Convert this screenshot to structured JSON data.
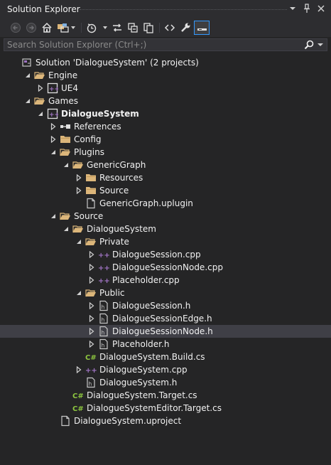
{
  "panel": {
    "title": "Solution Explorer",
    "title_icons": [
      "chevron-down-icon",
      "pin-icon",
      "close-icon"
    ]
  },
  "toolbar": {
    "buttons": [
      "back-icon",
      "forward-icon",
      "home-icon",
      "switch-views-icon",
      "pending-changes-filter-icon",
      "sync-icon",
      "collapse-all-icon",
      "show-all-files-icon",
      "view-code-icon",
      "properties-icon",
      "preview-selected-icon"
    ]
  },
  "search": {
    "placeholder": "Search Solution Explorer (Ctrl+;)",
    "value": ""
  },
  "colors": {
    "background": "#252526",
    "folder": "#dcb67a",
    "cpp": "#a074c4",
    "csharp": "#8dc63f",
    "selection": "#3f3f46",
    "accent": "#3399ff"
  },
  "tree": [
    {
      "label": "Solution 'DialogueSystem' (2 projects)",
      "icon": "solution-icon",
      "expander": "none",
      "bold": false
    },
    {
      "label": "Engine",
      "icon": "folder-open-icon",
      "expander": "expanded",
      "bold": false
    },
    {
      "label": "UE4",
      "icon": "cpp-project-icon",
      "expander": "collapsed",
      "bold": false
    },
    {
      "label": "Games",
      "icon": "folder-open-icon",
      "expander": "expanded",
      "bold": false
    },
    {
      "label": "DialogueSystem",
      "icon": "cpp-project-icon",
      "expander": "expanded",
      "bold": true
    },
    {
      "label": "References",
      "icon": "references-icon",
      "expander": "collapsed",
      "bold": false
    },
    {
      "label": "Config",
      "icon": "folder-icon",
      "expander": "collapsed",
      "bold": false
    },
    {
      "label": "Plugins",
      "icon": "folder-open-icon",
      "expander": "expanded",
      "bold": false
    },
    {
      "label": "GenericGraph",
      "icon": "folder-open-icon",
      "expander": "expanded",
      "bold": false
    },
    {
      "label": "Resources",
      "icon": "folder-icon",
      "expander": "collapsed",
      "bold": false
    },
    {
      "label": "Source",
      "icon": "folder-icon",
      "expander": "collapsed",
      "bold": false
    },
    {
      "label": "GenericGraph.uplugin",
      "icon": "file-icon",
      "expander": "none",
      "bold": false
    },
    {
      "label": "Source",
      "icon": "folder-open-icon",
      "expander": "expanded",
      "bold": false
    },
    {
      "label": "DialogueSystem",
      "icon": "folder-open-icon",
      "expander": "expanded",
      "bold": false
    },
    {
      "label": "Private",
      "icon": "folder-open-icon",
      "expander": "expanded",
      "bold": false
    },
    {
      "label": "DialogueSession.cpp",
      "icon": "cpp-file-icon",
      "expander": "collapsed",
      "bold": false
    },
    {
      "label": "DialogueSessionNode.cpp",
      "icon": "cpp-file-icon",
      "expander": "collapsed",
      "bold": false
    },
    {
      "label": "Placeholder.cpp",
      "icon": "cpp-file-icon",
      "expander": "collapsed",
      "bold": false
    },
    {
      "label": "Public",
      "icon": "folder-open-icon",
      "expander": "expanded",
      "bold": false
    },
    {
      "label": "DialogueSession.h",
      "icon": "header-file-icon",
      "expander": "collapsed",
      "bold": false
    },
    {
      "label": "DialogueSessionEdge.h",
      "icon": "header-file-icon",
      "expander": "collapsed",
      "bold": false
    },
    {
      "label": "DialogueSessionNode.h",
      "icon": "header-file-icon",
      "expander": "collapsed",
      "bold": false,
      "selected": true
    },
    {
      "label": "Placeholder.h",
      "icon": "header-file-icon",
      "expander": "collapsed",
      "bold": false
    },
    {
      "label": "DialogueSystem.Build.cs",
      "icon": "csharp-file-icon",
      "expander": "none",
      "bold": false
    },
    {
      "label": "DialogueSystem.cpp",
      "icon": "cpp-file-icon",
      "expander": "collapsed",
      "bold": false
    },
    {
      "label": "DialogueSystem.h",
      "icon": "header-file-icon",
      "expander": "none",
      "bold": false
    },
    {
      "label": "DialogueSystem.Target.cs",
      "icon": "csharp-file-icon",
      "expander": "none",
      "bold": false
    },
    {
      "label": "DialogueSystemEditor.Target.cs",
      "icon": "csharp-file-icon",
      "expander": "none",
      "bold": false
    },
    {
      "label": "DialogueSystem.uproject",
      "icon": "file-icon",
      "expander": "none",
      "bold": false
    }
  ]
}
